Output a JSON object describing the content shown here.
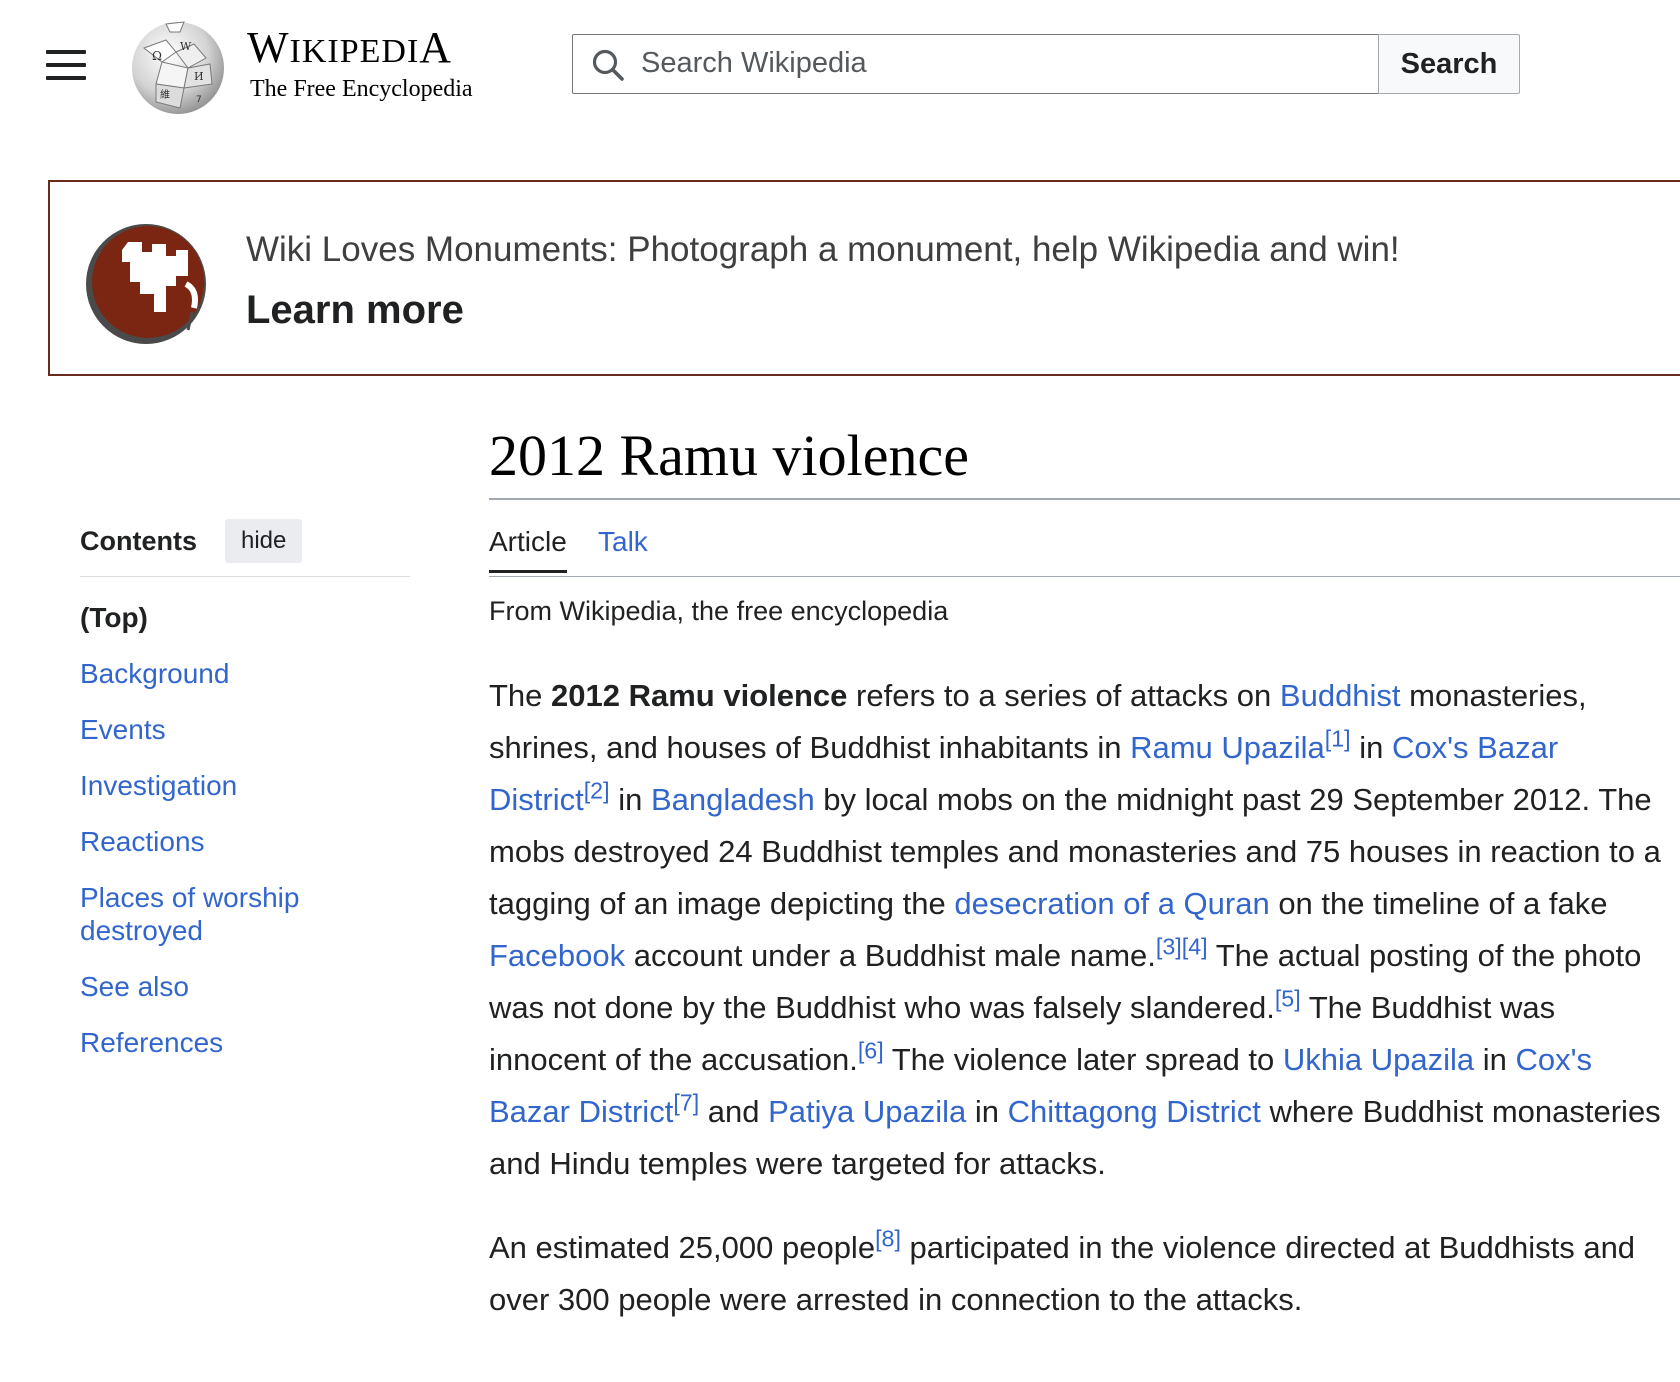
{
  "header": {
    "menu_icon": "hamburger-icon",
    "logo_icon": "wikipedia-globe-icon",
    "wordmark_big": "WIKIPEDIA",
    "wordmark_tagline": "The Free Encyclopedia",
    "search": {
      "placeholder": "Search Wikipedia",
      "value": "",
      "button_label": "Search",
      "icon": "search-icon"
    }
  },
  "banner": {
    "icon": "wiki-loves-monuments-icon",
    "text": "Wiki Loves Monuments: Photograph a monument, help Wikipedia and win!",
    "link_label": "Learn more",
    "border_color": "#6b2a1e"
  },
  "toc": {
    "title": "Contents",
    "hide_label": "hide",
    "top_label": "(Top)",
    "items": [
      "Background",
      "Events",
      "Investigation",
      "Reactions",
      "Places of worship destroyed",
      "See also",
      "References"
    ]
  },
  "article": {
    "title": "2012 Ramu violence",
    "tabs": [
      {
        "label": "Article",
        "active": true
      },
      {
        "label": "Talk",
        "active": false
      }
    ],
    "tagline": "From Wikipedia, the free encyclopedia",
    "p1": {
      "t1": "The ",
      "bold": "2012 Ramu violence",
      "t2": " refers to a series of attacks on ",
      "l_buddhist": "Buddhist",
      "t3": " monasteries, shrines, and houses of Buddhist inhabitants in ",
      "l_ramu": "Ramu Upazila",
      "r1": "[1]",
      "t4": " in ",
      "l_coxs": "Cox's Bazar District",
      "r2": "[2]",
      "t5": " in ",
      "l_bangladesh": "Bangladesh",
      "t6": " by local mobs on the midnight past 29 September 2012. The mobs destroyed 24 Buddhist temples and monasteries and 75 houses in reaction to a tagging of an image depicting the ",
      "l_desecration": "desecration of a Quran",
      "t7": " on the timeline of a fake ",
      "l_facebook": "Facebook",
      "t8": " account under a Buddhist male name.",
      "r3": "[3]",
      "r4": "[4]",
      "t9": " The actual posting of the photo was not done by the Buddhist who was falsely slandered.",
      "r5": "[5]",
      "t10": " The Buddhist was innocent of the accusation.",
      "r6": "[6]",
      "t11": " The violence later spread to ",
      "l_ukhia": "Ukhia Upazila",
      "t12": " in ",
      "l_coxs2": "Cox's Bazar District",
      "r7": "[7]",
      "t13": " and ",
      "l_patiya": "Patiya Upazila",
      "t14": " in ",
      "l_chittagong": "Chittagong District",
      "t15": " where Buddhist monasteries and Hindu temples were targeted for attacks."
    },
    "p2": {
      "t1": "An estimated 25,000 people",
      "r8": "[8]",
      "t2": " participated in the violence directed at Buddhists and over 300 people were arrested in connection to the attacks."
    }
  },
  "colors": {
    "link": "#3366cc",
    "text": "#202122",
    "border": "#a2a9b1"
  }
}
